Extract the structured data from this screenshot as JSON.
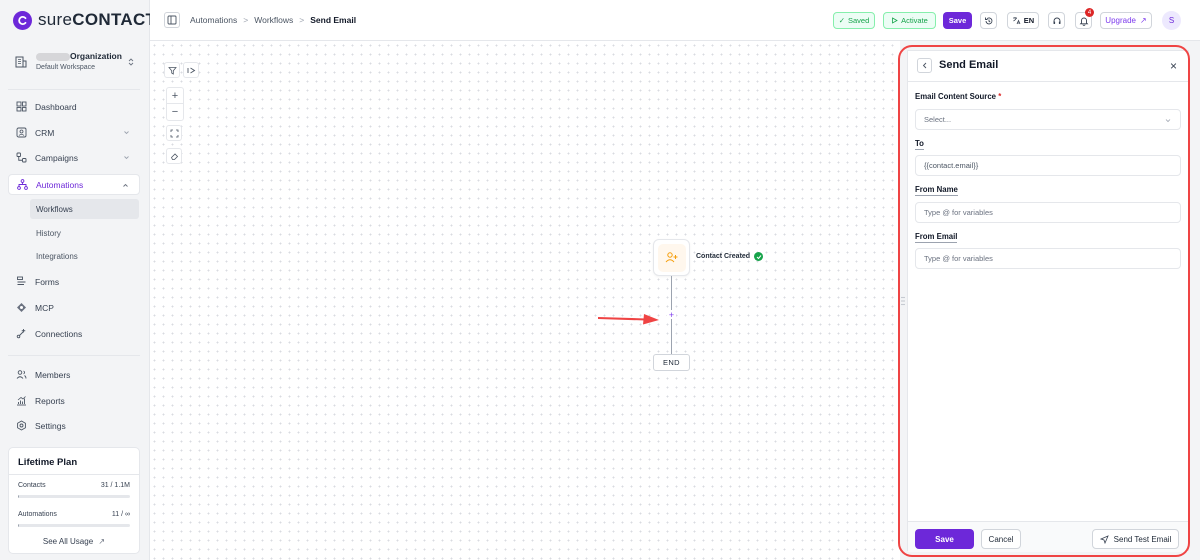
{
  "app": {
    "brand_light": "sure",
    "brand_bold": "CONTACT",
    "accent": "#6d28d9"
  },
  "org": {
    "name": "Organization",
    "workspace": "Default Workspace"
  },
  "nav": {
    "dashboard": "Dashboard",
    "crm": "CRM",
    "campaigns": "Campaigns",
    "automations": "Automations",
    "workflows": "Workflows",
    "history": "History",
    "integrations": "Integrations",
    "forms": "Forms",
    "mcp": "MCP",
    "connections": "Connections",
    "members": "Members",
    "reports": "Reports",
    "settings": "Settings"
  },
  "plan": {
    "title": "Lifetime Plan",
    "contacts_label": "Contacts",
    "contacts_value": "31 / 1.1M",
    "contacts_fraction": 0.01,
    "automations_label": "Automations",
    "automations_value": "11 / ∞",
    "automations_fraction": 0.01,
    "see_all": "See All Usage"
  },
  "topbar": {
    "crumbs": [
      "Automations",
      "Workflows",
      "Send Email"
    ],
    "crumb_sep": ">",
    "saved": "Saved",
    "activate": "Activate",
    "save": "Save",
    "lang": "EN",
    "notif_count": "4",
    "upgrade": "Upgrade",
    "avatar": "S"
  },
  "canvas": {
    "trigger_label": "Contact Created",
    "add_step": "+",
    "end": "END"
  },
  "panel": {
    "title": "Send Email",
    "close": "×",
    "content_source_label": "Email Content Source",
    "required_mark": "*",
    "content_source_placeholder": "Select...",
    "to_label": "To",
    "to_value": "{{contact.email}}",
    "from_name_label": "From Name",
    "from_name_placeholder": "Type @ for variables",
    "from_email_label": "From Email",
    "from_email_placeholder": "Type @ for variables",
    "save": "Save",
    "cancel": "Cancel",
    "send_test": "Send Test Email"
  }
}
